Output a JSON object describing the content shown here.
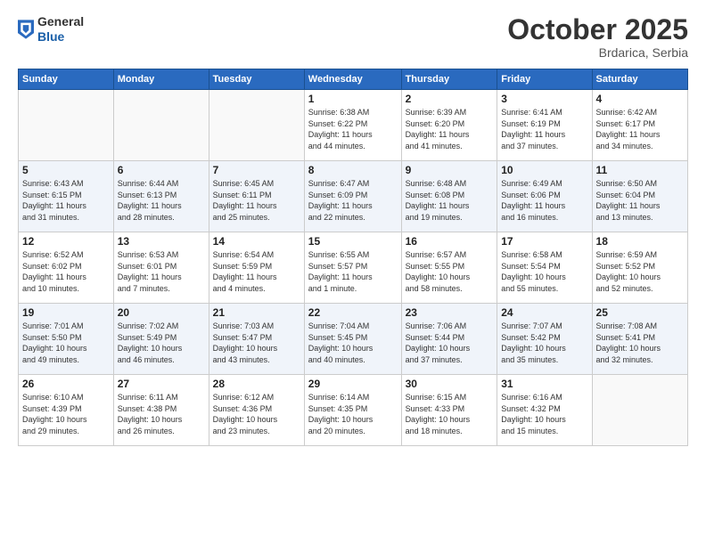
{
  "header": {
    "logo_general": "General",
    "logo_blue": "Blue",
    "month": "October 2025",
    "location": "Brdarica, Serbia"
  },
  "days_of_week": [
    "Sunday",
    "Monday",
    "Tuesday",
    "Wednesday",
    "Thursday",
    "Friday",
    "Saturday"
  ],
  "weeks": [
    {
      "shade": false,
      "days": [
        {
          "num": "",
          "info": ""
        },
        {
          "num": "",
          "info": ""
        },
        {
          "num": "",
          "info": ""
        },
        {
          "num": "1",
          "info": "Sunrise: 6:38 AM\nSunset: 6:22 PM\nDaylight: 11 hours\nand 44 minutes."
        },
        {
          "num": "2",
          "info": "Sunrise: 6:39 AM\nSunset: 6:20 PM\nDaylight: 11 hours\nand 41 minutes."
        },
        {
          "num": "3",
          "info": "Sunrise: 6:41 AM\nSunset: 6:19 PM\nDaylight: 11 hours\nand 37 minutes."
        },
        {
          "num": "4",
          "info": "Sunrise: 6:42 AM\nSunset: 6:17 PM\nDaylight: 11 hours\nand 34 minutes."
        }
      ]
    },
    {
      "shade": true,
      "days": [
        {
          "num": "5",
          "info": "Sunrise: 6:43 AM\nSunset: 6:15 PM\nDaylight: 11 hours\nand 31 minutes."
        },
        {
          "num": "6",
          "info": "Sunrise: 6:44 AM\nSunset: 6:13 PM\nDaylight: 11 hours\nand 28 minutes."
        },
        {
          "num": "7",
          "info": "Sunrise: 6:45 AM\nSunset: 6:11 PM\nDaylight: 11 hours\nand 25 minutes."
        },
        {
          "num": "8",
          "info": "Sunrise: 6:47 AM\nSunset: 6:09 PM\nDaylight: 11 hours\nand 22 minutes."
        },
        {
          "num": "9",
          "info": "Sunrise: 6:48 AM\nSunset: 6:08 PM\nDaylight: 11 hours\nand 19 minutes."
        },
        {
          "num": "10",
          "info": "Sunrise: 6:49 AM\nSunset: 6:06 PM\nDaylight: 11 hours\nand 16 minutes."
        },
        {
          "num": "11",
          "info": "Sunrise: 6:50 AM\nSunset: 6:04 PM\nDaylight: 11 hours\nand 13 minutes."
        }
      ]
    },
    {
      "shade": false,
      "days": [
        {
          "num": "12",
          "info": "Sunrise: 6:52 AM\nSunset: 6:02 PM\nDaylight: 11 hours\nand 10 minutes."
        },
        {
          "num": "13",
          "info": "Sunrise: 6:53 AM\nSunset: 6:01 PM\nDaylight: 11 hours\nand 7 minutes."
        },
        {
          "num": "14",
          "info": "Sunrise: 6:54 AM\nSunset: 5:59 PM\nDaylight: 11 hours\nand 4 minutes."
        },
        {
          "num": "15",
          "info": "Sunrise: 6:55 AM\nSunset: 5:57 PM\nDaylight: 11 hours\nand 1 minute."
        },
        {
          "num": "16",
          "info": "Sunrise: 6:57 AM\nSunset: 5:55 PM\nDaylight: 10 hours\nand 58 minutes."
        },
        {
          "num": "17",
          "info": "Sunrise: 6:58 AM\nSunset: 5:54 PM\nDaylight: 10 hours\nand 55 minutes."
        },
        {
          "num": "18",
          "info": "Sunrise: 6:59 AM\nSunset: 5:52 PM\nDaylight: 10 hours\nand 52 minutes."
        }
      ]
    },
    {
      "shade": true,
      "days": [
        {
          "num": "19",
          "info": "Sunrise: 7:01 AM\nSunset: 5:50 PM\nDaylight: 10 hours\nand 49 minutes."
        },
        {
          "num": "20",
          "info": "Sunrise: 7:02 AM\nSunset: 5:49 PM\nDaylight: 10 hours\nand 46 minutes."
        },
        {
          "num": "21",
          "info": "Sunrise: 7:03 AM\nSunset: 5:47 PM\nDaylight: 10 hours\nand 43 minutes."
        },
        {
          "num": "22",
          "info": "Sunrise: 7:04 AM\nSunset: 5:45 PM\nDaylight: 10 hours\nand 40 minutes."
        },
        {
          "num": "23",
          "info": "Sunrise: 7:06 AM\nSunset: 5:44 PM\nDaylight: 10 hours\nand 37 minutes."
        },
        {
          "num": "24",
          "info": "Sunrise: 7:07 AM\nSunset: 5:42 PM\nDaylight: 10 hours\nand 35 minutes."
        },
        {
          "num": "25",
          "info": "Sunrise: 7:08 AM\nSunset: 5:41 PM\nDaylight: 10 hours\nand 32 minutes."
        }
      ]
    },
    {
      "shade": false,
      "days": [
        {
          "num": "26",
          "info": "Sunrise: 6:10 AM\nSunset: 4:39 PM\nDaylight: 10 hours\nand 29 minutes."
        },
        {
          "num": "27",
          "info": "Sunrise: 6:11 AM\nSunset: 4:38 PM\nDaylight: 10 hours\nand 26 minutes."
        },
        {
          "num": "28",
          "info": "Sunrise: 6:12 AM\nSunset: 4:36 PM\nDaylight: 10 hours\nand 23 minutes."
        },
        {
          "num": "29",
          "info": "Sunrise: 6:14 AM\nSunset: 4:35 PM\nDaylight: 10 hours\nand 20 minutes."
        },
        {
          "num": "30",
          "info": "Sunrise: 6:15 AM\nSunset: 4:33 PM\nDaylight: 10 hours\nand 18 minutes."
        },
        {
          "num": "31",
          "info": "Sunrise: 6:16 AM\nSunset: 4:32 PM\nDaylight: 10 hours\nand 15 minutes."
        },
        {
          "num": "",
          "info": ""
        }
      ]
    }
  ]
}
